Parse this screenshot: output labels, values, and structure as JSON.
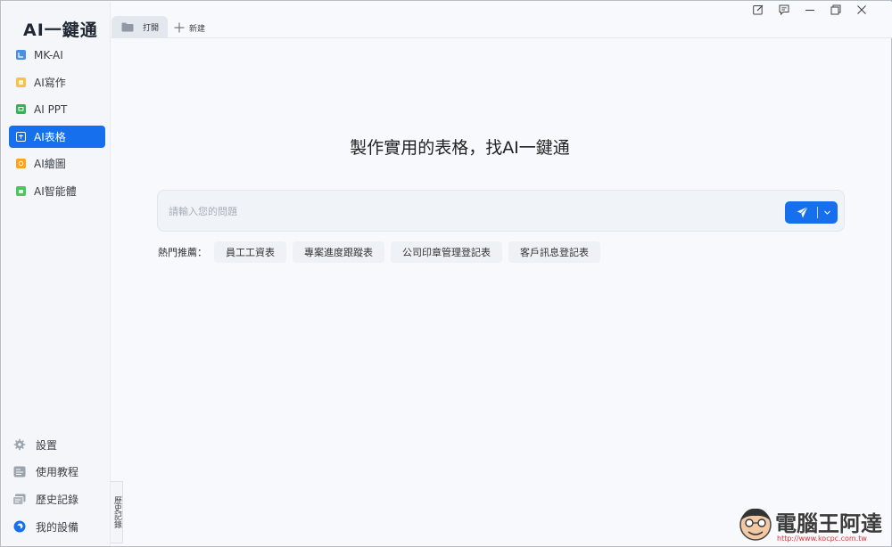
{
  "app": {
    "logo": "AI一鍵通"
  },
  "sidebar": {
    "items": [
      {
        "label": "MK-AI",
        "icon": "mk-ai-icon",
        "color": "#4a90e2",
        "active": false
      },
      {
        "label": "AI寫作",
        "icon": "writing-icon",
        "color": "#f6c445",
        "active": false
      },
      {
        "label": "AI PPT",
        "icon": "ppt-icon",
        "color": "#34b356",
        "active": false
      },
      {
        "label": "AI表格",
        "icon": "table-icon",
        "color": "#1670ee",
        "active": true
      },
      {
        "label": "AI繪圖",
        "icon": "drawing-icon",
        "color": "#f3a81c",
        "active": false
      },
      {
        "label": "AI智能體",
        "icon": "agent-icon",
        "color": "#4cc65d",
        "active": false
      }
    ],
    "bottom": [
      {
        "label": "設置",
        "icon": "gear-icon"
      },
      {
        "label": "使用教程",
        "icon": "tutorial-icon"
      },
      {
        "label": "歷史記錄",
        "icon": "history-icon"
      },
      {
        "label": "我的設備",
        "icon": "device-icon"
      }
    ],
    "history_tab": "歷史記錄"
  },
  "tabs": {
    "open_label": "打開",
    "new_label": "新建"
  },
  "main": {
    "headline": "製作實用的表格，找AI一鍵通",
    "search_placeholder": "請輸入您的問題",
    "hot_label": "熱門推薦：",
    "suggestions": [
      "員工工資表",
      "專案進度跟蹤表",
      "公司印章管理登記表",
      "客戶訊息登記表"
    ]
  },
  "watermark": {
    "text": "電腦王阿達",
    "url": "http://www.kocpc.com.tw"
  },
  "colors": {
    "accent": "#1670ee"
  }
}
